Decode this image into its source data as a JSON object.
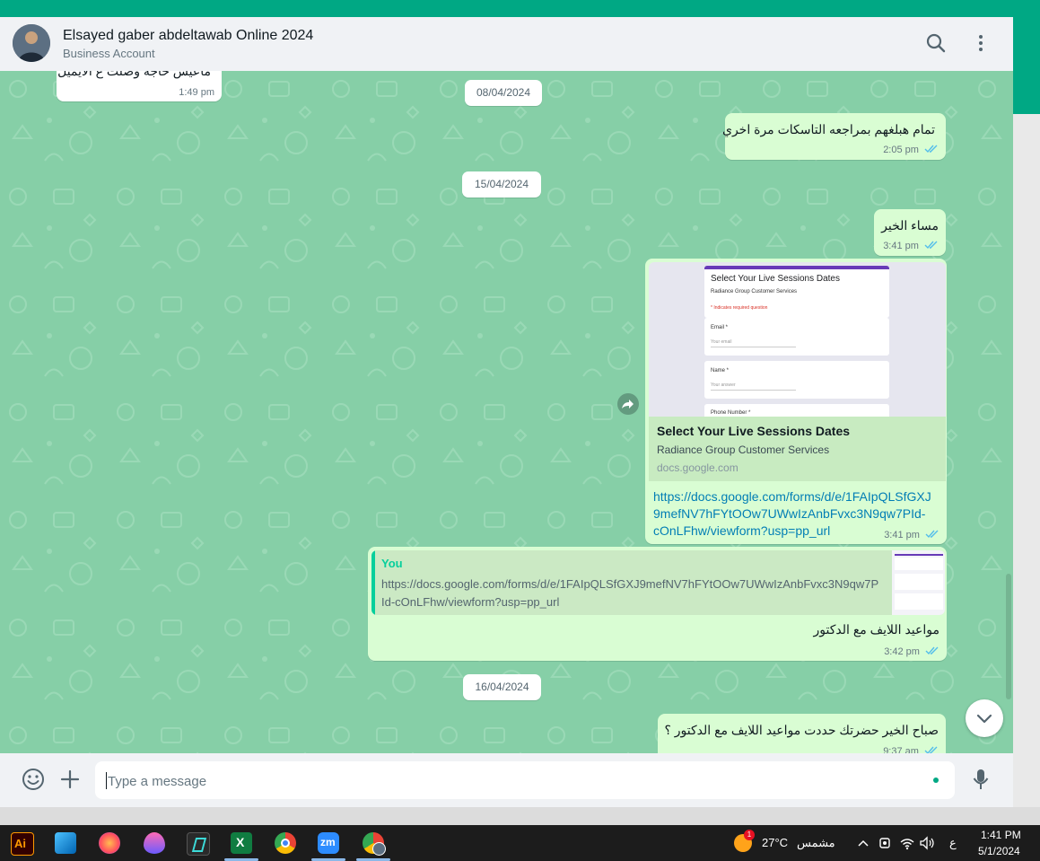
{
  "header": {
    "contact_name": "Elsayed gaber abdeltawab Online 2024",
    "subtitle": "Business Account"
  },
  "messages": {
    "m1_text": "ماعيش حاجة وصلت ع الايميل",
    "m1_time": "1:49 pm",
    "d1": "08/04/2024",
    "m2_text": "تمام هبلغهم بمراجعه التاسكات مرة اخري",
    "m2_time": "2:05 pm",
    "d2": "15/04/2024",
    "m3_text": "مساء الخير",
    "m3_time": "3:41 pm",
    "m4_preview_form_title": "Select Your Live Sessions Dates",
    "m4_preview_form_org": "Radiance Group Customer Services",
    "m4_preview_required": "* Indicates required question",
    "m4_preview_email": "Email *",
    "m4_preview_email_ph": "Your email",
    "m4_preview_name": "Name *",
    "m4_preview_name_ph": "Your answer",
    "m4_preview_phone": "Phone Number *",
    "m4_link_title": "Select Your Live Sessions Dates",
    "m4_link_desc": "Radiance Group Customer Services",
    "m4_link_domain": "docs.google.com",
    "m4_url_line1": "https://docs.google.com/forms/d/e/1FAIpQLSfGXJ",
    "m4_url_line2": "9mefNV7hFYtOOw7UWwIzAnbFvxc3N9qw7PId-",
    "m4_url_line3": "cOnLFhw/viewform?usp=pp_url",
    "m4_time": "3:41 pm",
    "m5_quote_author": "You",
    "m5_quote_line1": "https://docs.google.com/forms/d/e/1FAIpQLSfGXJ9mefNV7hFYtOOw7UWwIzAnbFvxc3N9qw7P",
    "m5_quote_line2": "Id-cOnLFhw/viewform?usp=pp_url",
    "m5_text": "مواعيد اللايف مع الدكتور",
    "m5_time": "3:42 pm",
    "d3": "16/04/2024",
    "m6_text": "صباح الخير حضرتك حددت مواعيد اللايف مع الدكتور ؟",
    "m6_time": "9:37 am"
  },
  "composer": {
    "placeholder": "Type a message"
  },
  "taskbar": {
    "weather_temp": "27°C",
    "weather_desc": "مشمس",
    "weather_badge": "1",
    "lang": "ع",
    "time": "1:41 PM",
    "date": "5/1/2024",
    "apps": [
      "illustrator",
      "photos",
      "firefox",
      "paint",
      "capcut",
      "excel",
      "chrome",
      "zoom",
      "chrome-profile"
    ]
  },
  "colors": {
    "accent": "#00a884",
    "chat_bg": "#86cfa7",
    "outgoing": "#d9fdd3",
    "read_tick": "#53bdeb",
    "link": "#027eb5"
  }
}
